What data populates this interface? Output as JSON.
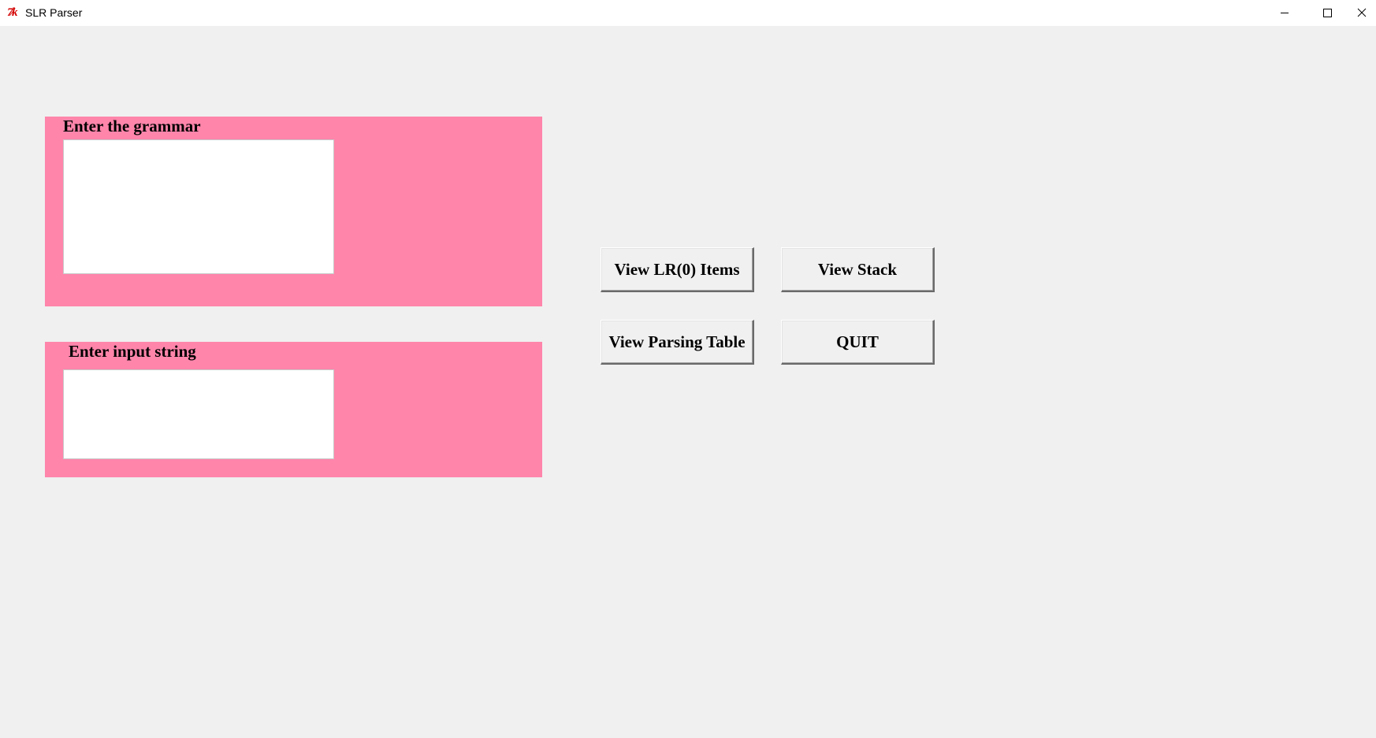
{
  "window": {
    "title": "SLR Parser",
    "icon": "tk-feather-icon",
    "controls": [
      "minimize-icon",
      "maximize-icon",
      "close-icon"
    ]
  },
  "grammar_panel": {
    "label": "Enter the grammar",
    "value": ""
  },
  "input_panel": {
    "label": "Enter input string",
    "value": ""
  },
  "buttons": {
    "view_lr0": "View LR(0) Items",
    "view_stack": "View Stack",
    "view_table": "View Parsing Table",
    "quit": "QUIT"
  },
  "colors": {
    "frame_background": "#ff85ab",
    "window_background": "#f0f0f0"
  }
}
